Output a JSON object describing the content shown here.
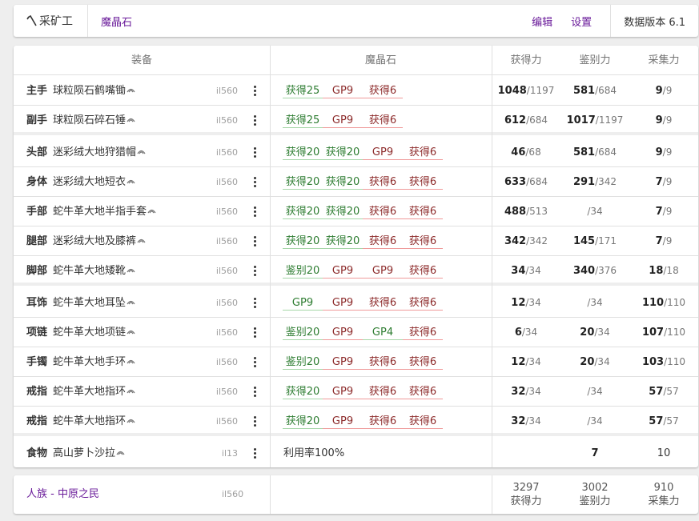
{
  "topbar": {
    "app_label": "采矿工",
    "crystal_label": "魔晶石",
    "edit_label": "编辑",
    "settings_label": "设置",
    "version_label": "数据版本 6.1"
  },
  "headers": {
    "equipment": "装备",
    "materia": "魔晶石",
    "gathering": "获得力",
    "perception": "鉴别力",
    "gp": "采集力"
  },
  "rows": [
    {
      "slot": "主手",
      "name": "球粒陨石鹤嘴锄",
      "ilvl": "il560",
      "materia": [
        {
          "t": "获得25",
          "k": "gat"
        },
        {
          "t": "GP9",
          "k": "gp"
        },
        {
          "t": "获得6",
          "k": "mat6"
        }
      ],
      "gathering": "1048",
      "gathering_max": "/1197",
      "perception": "581",
      "perception_max": "/684",
      "gp": "9",
      "gp_max": "/9"
    },
    {
      "slot": "副手",
      "name": "球粒陨石碎石锤",
      "ilvl": "il560",
      "materia": [
        {
          "t": "获得25",
          "k": "gat"
        },
        {
          "t": "GP9",
          "k": "gp"
        },
        {
          "t": "获得6",
          "k": "mat6"
        }
      ],
      "gathering": "612",
      "gathering_max": "/684",
      "perception": "1017",
      "perception_max": "/1197",
      "gp": "9",
      "gp_max": "/9"
    },
    {
      "slot": "头部",
      "name": "迷彩绒大地狩猎帽",
      "ilvl": "il560",
      "materia": [
        {
          "t": "获得20",
          "k": "gat"
        },
        {
          "t": "获得20",
          "k": "gat"
        },
        {
          "t": "GP9",
          "k": "gp"
        },
        {
          "t": "获得6",
          "k": "mat6"
        }
      ],
      "gathering": "46",
      "gathering_max": "/68",
      "perception": "581",
      "perception_max": "/684",
      "gp": "9",
      "gp_max": "/9"
    },
    {
      "slot": "身体",
      "name": "迷彩绒大地短衣",
      "ilvl": "il560",
      "materia": [
        {
          "t": "获得20",
          "k": "gat"
        },
        {
          "t": "获得20",
          "k": "gat"
        },
        {
          "t": "获得6",
          "k": "mat6"
        },
        {
          "t": "获得6",
          "k": "mat6"
        }
      ],
      "gathering": "633",
      "gathering_max": "/684",
      "perception": "291",
      "perception_max": "/342",
      "gp": "7",
      "gp_max": "/9"
    },
    {
      "slot": "手部",
      "name": "蛇牛革大地半指手套",
      "ilvl": "il560",
      "materia": [
        {
          "t": "获得20",
          "k": "gat"
        },
        {
          "t": "获得20",
          "k": "gat"
        },
        {
          "t": "获得6",
          "k": "mat6"
        },
        {
          "t": "获得6",
          "k": "mat6"
        }
      ],
      "gathering": "488",
      "gathering_max": "/513",
      "perception": "",
      "perception_max": "/34",
      "gp": "7",
      "gp_max": "/9"
    },
    {
      "slot": "腿部",
      "name": "迷彩绒大地及膝裤",
      "ilvl": "il560",
      "materia": [
        {
          "t": "获得20",
          "k": "gat"
        },
        {
          "t": "获得20",
          "k": "gat"
        },
        {
          "t": "获得6",
          "k": "mat6"
        },
        {
          "t": "获得6",
          "k": "mat6"
        }
      ],
      "gathering": "342",
      "gathering_max": "/342",
      "perception": "145",
      "perception_max": "/171",
      "gp": "7",
      "gp_max": "/9"
    },
    {
      "slot": "脚部",
      "name": "蛇牛革大地矮靴",
      "ilvl": "il560",
      "materia": [
        {
          "t": "鉴别20",
          "k": "per"
        },
        {
          "t": "GP9",
          "k": "gp"
        },
        {
          "t": "GP9",
          "k": "gp"
        },
        {
          "t": "获得6",
          "k": "mat6"
        }
      ],
      "gathering": "34",
      "gathering_max": "/34",
      "perception": "340",
      "perception_max": "/376",
      "gp": "18",
      "gp_max": "/18"
    },
    {
      "slot": "耳饰",
      "name": "蛇牛革大地耳坠",
      "ilvl": "il560",
      "materia": [
        {
          "t": "GP9",
          "k": "gat"
        },
        {
          "t": "GP9",
          "k": "gp"
        },
        {
          "t": "获得6",
          "k": "mat6"
        },
        {
          "t": "获得6",
          "k": "mat6"
        }
      ],
      "gathering": "12",
      "gathering_max": "/34",
      "perception": "",
      "perception_max": "/34",
      "gp": "110",
      "gp_max": "/110"
    },
    {
      "slot": "项链",
      "name": "蛇牛革大地项链",
      "ilvl": "il560",
      "materia": [
        {
          "t": "鉴别20",
          "k": "per"
        },
        {
          "t": "GP9",
          "k": "gp"
        },
        {
          "t": "GP4",
          "k": "gat"
        },
        {
          "t": "获得6",
          "k": "mat6"
        }
      ],
      "gathering": "6",
      "gathering_max": "/34",
      "perception": "20",
      "perception_max": "/34",
      "gp": "107",
      "gp_max": "/110"
    },
    {
      "slot": "手镯",
      "name": "蛇牛革大地手环",
      "ilvl": "il560",
      "materia": [
        {
          "t": "鉴别20",
          "k": "per"
        },
        {
          "t": "GP9",
          "k": "gp"
        },
        {
          "t": "获得6",
          "k": "mat6"
        },
        {
          "t": "获得6",
          "k": "mat6"
        }
      ],
      "gathering": "12",
      "gathering_max": "/34",
      "perception": "20",
      "perception_max": "/34",
      "gp": "103",
      "gp_max": "/110"
    },
    {
      "slot": "戒指",
      "name": "蛇牛革大地指环",
      "ilvl": "il560",
      "materia": [
        {
          "t": "获得20",
          "k": "gat"
        },
        {
          "t": "GP9",
          "k": "gp"
        },
        {
          "t": "获得6",
          "k": "mat6"
        },
        {
          "t": "获得6",
          "k": "mat6"
        }
      ],
      "gathering": "32",
      "gathering_max": "/34",
      "perception": "",
      "perception_max": "/34",
      "gp": "57",
      "gp_max": "/57"
    },
    {
      "slot": "戒指",
      "name": "蛇牛革大地指环",
      "ilvl": "il560",
      "materia": [
        {
          "t": "获得20",
          "k": "gat"
        },
        {
          "t": "GP9",
          "k": "gp"
        },
        {
          "t": "获得6",
          "k": "mat6"
        },
        {
          "t": "获得6",
          "k": "mat6"
        }
      ],
      "gathering": "32",
      "gathering_max": "/34",
      "perception": "",
      "perception_max": "/34",
      "gp": "57",
      "gp_max": "/57"
    }
  ],
  "food": {
    "slot": "食物",
    "name": "高山萝卜沙拉",
    "ilvl": "il13",
    "utilization": "利用率100%",
    "perception": "7",
    "gp": "10"
  },
  "footer": {
    "race": "人族 - 中原之民",
    "ilvl": "il560",
    "total_gathering": "3297",
    "total_gathering_label": "获得力",
    "total_perception": "3002",
    "total_perception_label": "鉴别力",
    "total_gp": "910",
    "total_gp_label": "采集力"
  },
  "colors": {
    "accent": "#6a1b9a",
    "materia_green": "#2e7d32",
    "materia_red": "#8d2b2b"
  }
}
